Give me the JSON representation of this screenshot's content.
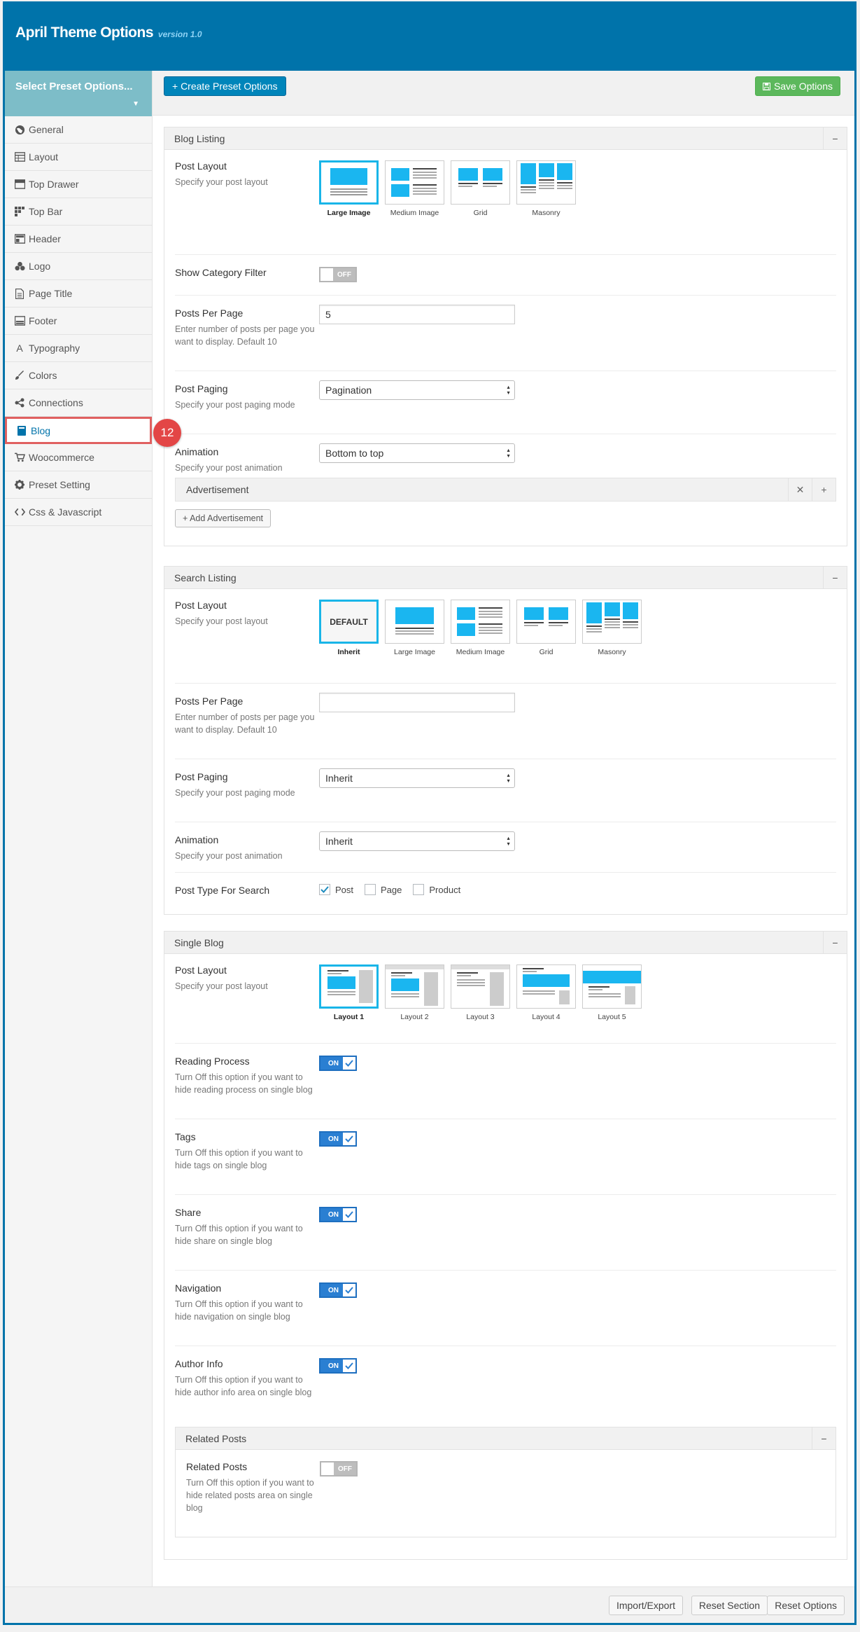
{
  "app": {
    "title": "April Theme Options",
    "version": "version 1.0"
  },
  "sidebar": {
    "preset_select": "Select Preset Options...",
    "items": [
      {
        "label": "General"
      },
      {
        "label": "Layout"
      },
      {
        "label": "Top Drawer"
      },
      {
        "label": "Top Bar"
      },
      {
        "label": "Header"
      },
      {
        "label": "Logo"
      },
      {
        "label": "Page Title"
      },
      {
        "label": "Footer"
      },
      {
        "label": "Typography"
      },
      {
        "label": "Colors"
      },
      {
        "label": "Connections"
      },
      {
        "label": "Blog"
      },
      {
        "label": "Woocommerce"
      },
      {
        "label": "Preset Setting"
      },
      {
        "label": "Css & Javascript"
      }
    ],
    "active_item": "Blog",
    "step_badge": "12"
  },
  "toolbar": {
    "create_label": "+ Create Preset Options",
    "save_label": "Save Options"
  },
  "blog_listing": {
    "title": "Blog Listing",
    "post_layout": {
      "label": "Post Layout",
      "desc": "Specify your post layout",
      "options": [
        "Large Image",
        "Medium Image",
        "Grid",
        "Masonry"
      ],
      "selected": "Large Image"
    },
    "show_category_filter": {
      "label": "Show Category Filter",
      "state": "OFF"
    },
    "posts_per_page": {
      "label": "Posts Per Page",
      "desc": "Enter number of posts per page you want to display. Default 10",
      "value": "5"
    },
    "post_paging": {
      "label": "Post Paging",
      "desc": "Specify your post paging mode",
      "value": "Pagination"
    },
    "animation": {
      "label": "Animation",
      "desc": "Specify your post animation",
      "value": "Bottom to top"
    },
    "advertisement": {
      "title": "Advertisement",
      "add_label": "+ Add Advertisement"
    }
  },
  "search_listing": {
    "title": "Search Listing",
    "post_layout": {
      "label": "Post Layout",
      "desc": "Specify your post layout",
      "default_text": "DEFAULT",
      "options": [
        "Inherit",
        "Large Image",
        "Medium Image",
        "Grid",
        "Masonry"
      ],
      "selected": "Inherit"
    },
    "posts_per_page": {
      "label": "Posts Per Page",
      "desc": "Enter number of posts per page you want to display. Default 10",
      "value": ""
    },
    "post_paging": {
      "label": "Post Paging",
      "desc": "Specify your post paging mode",
      "value": "Inherit"
    },
    "animation": {
      "label": "Animation",
      "desc": "Specify your post animation",
      "value": "Inherit"
    },
    "post_type": {
      "label": "Post Type For Search",
      "options": [
        {
          "label": "Post",
          "checked": true
        },
        {
          "label": "Page",
          "checked": false
        },
        {
          "label": "Product",
          "checked": false
        }
      ]
    }
  },
  "single_blog": {
    "title": "Single Blog",
    "post_layout": {
      "label": "Post Layout",
      "desc": "Specify your post layout",
      "options": [
        "Layout 1",
        "Layout 2",
        "Layout 3",
        "Layout 4",
        "Layout 5"
      ],
      "selected": "Layout 1"
    },
    "reading_process": {
      "label": "Reading Process",
      "desc": "Turn Off this option if you want to hide reading process on single blog",
      "state": "ON"
    },
    "tags": {
      "label": "Tags",
      "desc": "Turn Off this option if you want to hide tags on single blog",
      "state": "ON"
    },
    "share": {
      "label": "Share",
      "desc": "Turn Off this option if you want to hide share on single blog",
      "state": "ON"
    },
    "navigation": {
      "label": "Navigation",
      "desc": "Turn Off this option if you want to hide navigation on single blog",
      "state": "ON"
    },
    "author_info": {
      "label": "Author Info",
      "desc": "Turn Off this option if you want to hide author info area on single blog",
      "state": "ON"
    },
    "related_posts_section": {
      "title": "Related Posts",
      "related_posts": {
        "label": "Related Posts",
        "desc": "Turn Off this option if you want to hide related posts area on single blog",
        "state": "OFF"
      }
    }
  },
  "footer": {
    "import_export": "Import/Export",
    "reset_section": "Reset Section",
    "reset_options": "Reset Options"
  },
  "colors": {
    "primary": "#0073aa",
    "accent_blue": "#19b5e8",
    "save_green": "#5cb85c",
    "toggle_on": "#2a7fd2",
    "badge_red": "#e34646"
  }
}
